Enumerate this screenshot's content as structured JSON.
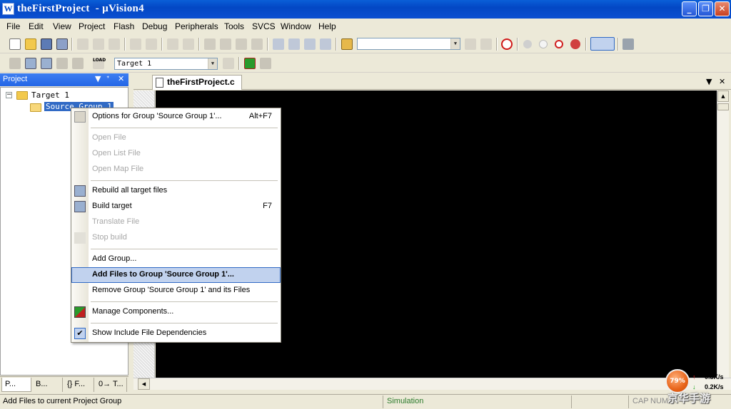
{
  "window": {
    "app_icon": "W",
    "title": "theFirstProject  - µVision4",
    "minimize": "_",
    "restore": "❐",
    "close": "✕"
  },
  "menu": [
    "File",
    "Edit",
    "View",
    "Project",
    "Flash",
    "Debug",
    "Peripherals",
    "Tools",
    "SVCS",
    "Window",
    "Help"
  ],
  "toolbar2": {
    "load_label": "LOAD",
    "target_select": "Target 1"
  },
  "project_panel": {
    "title": "Project",
    "pin": "ᐩ",
    "close": "✕",
    "tree": {
      "target": "Target 1",
      "group": "Source Group 1",
      "expander": "−"
    },
    "tabs": [
      "P...",
      "B...",
      "{} F...",
      "0→ T..."
    ]
  },
  "editor": {
    "tab_label": "theFirstProject.c",
    "dropdown": "▼",
    "close": "✕"
  },
  "context_menu": {
    "items": [
      {
        "label": "Options for Group 'Source Group 1'...",
        "accel": "Alt+F7",
        "enabled": true,
        "icon": "wand-icon"
      },
      {
        "label": "Open File",
        "enabled": false
      },
      {
        "label": "Open List File",
        "enabled": false
      },
      {
        "label": "Open Map File",
        "enabled": false
      },
      {
        "label": "Rebuild all target files",
        "enabled": true,
        "icon": "rebuild-icon"
      },
      {
        "label": "Build target",
        "accel": "F7",
        "enabled": true,
        "icon": "build-icon"
      },
      {
        "label": "Translate File",
        "enabled": false
      },
      {
        "label": "Stop build",
        "enabled": false,
        "icon": "stop-build-icon"
      },
      {
        "label": "Add Group...",
        "enabled": true
      },
      {
        "label": "Add Files to Group 'Source Group 1'...",
        "enabled": true,
        "highlighted": true
      },
      {
        "label": "Remove Group 'Source Group 1' and its Files",
        "enabled": true
      },
      {
        "label": "Manage Components...",
        "enabled": true,
        "icon": "components-icon"
      },
      {
        "label": "Show Include File Dependencies",
        "enabled": true,
        "checked": true
      }
    ]
  },
  "statusbar": {
    "message": "Add Files to current Project Group",
    "mode": "Simulation",
    "caps": "CAP",
    "num": "NUM"
  },
  "net_widget": {
    "percent": "79%",
    "upload": "0.3K/s",
    "download": "0.2K/s",
    "up_arrow": "↑",
    "down_arrow": "↓"
  },
  "watermark": "京华手游",
  "colors": {
    "titlebar": "#0347c4",
    "menu_highlight": "#c1d2ee",
    "editor_bg": "#000000"
  }
}
